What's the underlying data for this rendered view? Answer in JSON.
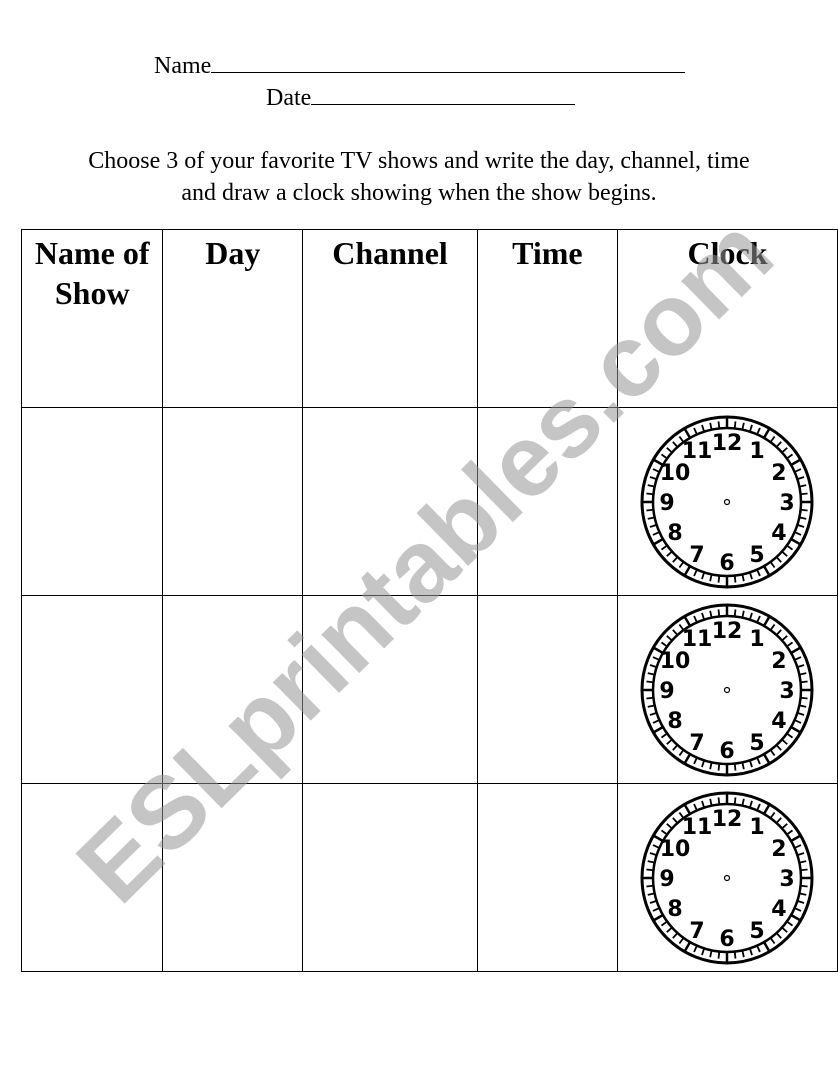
{
  "header": {
    "name_label": "Name",
    "date_label": "Date"
  },
  "instructions": [
    "Choose 3 of your favorite TV shows and write the day, channel, time",
    "and draw a clock showing when the show begins."
  ],
  "table": {
    "columns": [
      "Name of Show",
      "Day",
      "Channel",
      "Time",
      "Clock"
    ],
    "row_count": 3
  },
  "clock_numbers": [
    "12",
    "1",
    "2",
    "3",
    "4",
    "5",
    "6",
    "7",
    "8",
    "9",
    "10",
    "11"
  ],
  "watermark": "ESLprintables.com"
}
